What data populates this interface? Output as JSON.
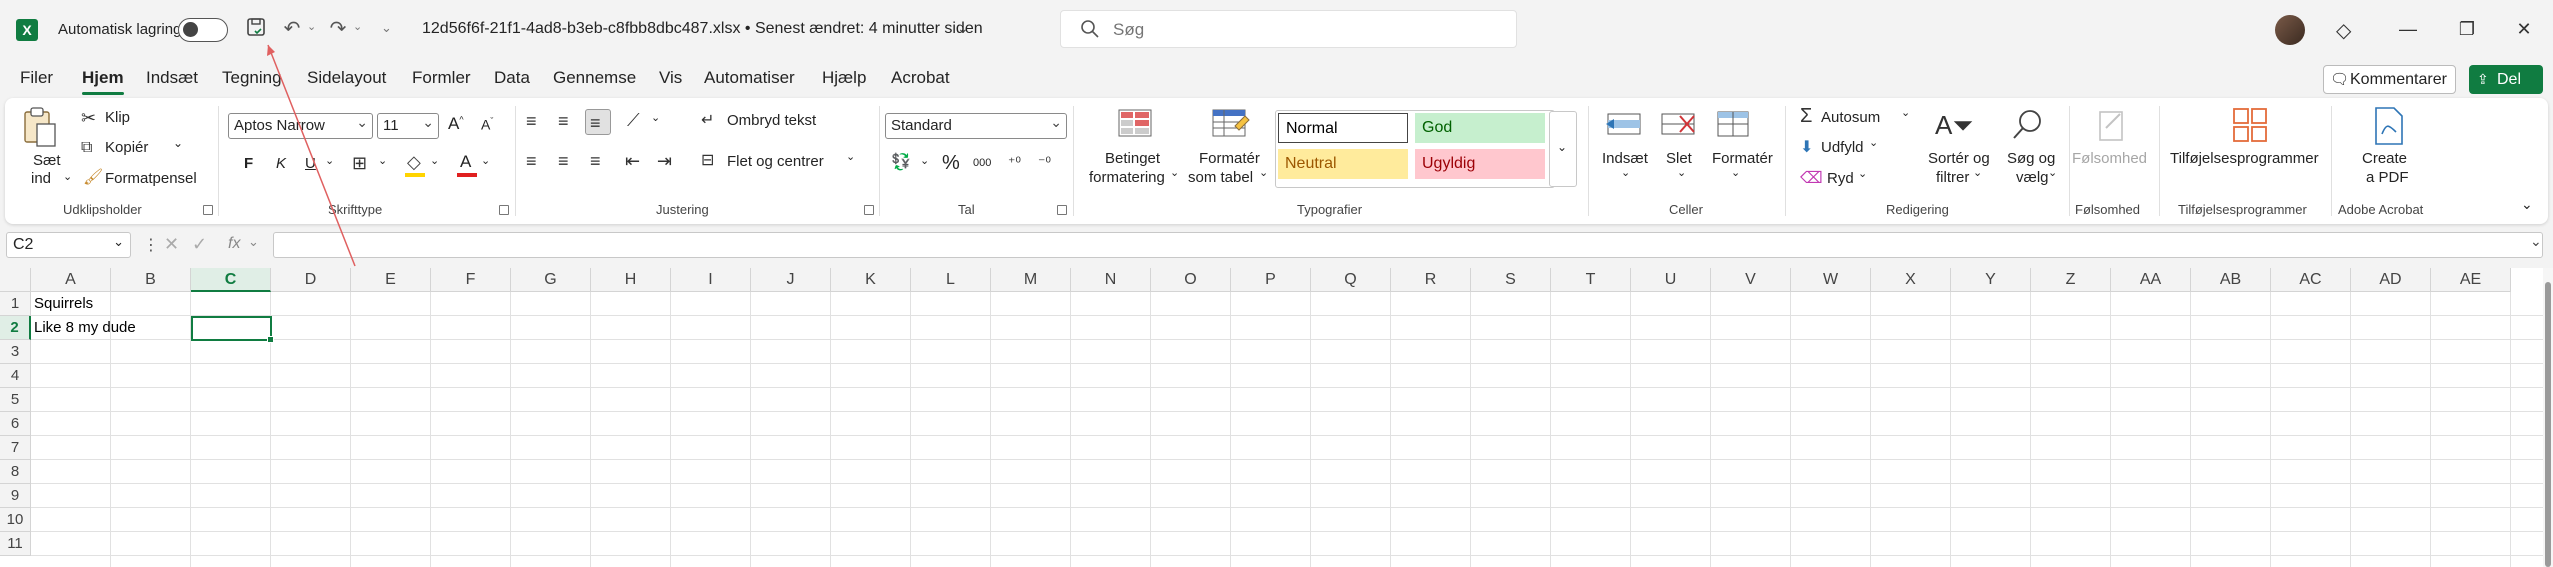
{
  "titlebar": {
    "autosave_label": "Automatisk lagring",
    "doc_title": "12d56f6f-21f1-4ad8-b3eb-c8fbb8dbc487.xlsx • Senest ændret: 4 minutter siden",
    "search_placeholder": "Søg"
  },
  "menu": {
    "tabs": [
      "Filer",
      "Hjem",
      "Indsæt",
      "Tegning",
      "Sidelayout",
      "Formler",
      "Data",
      "Gennemse",
      "Vis",
      "Automatiser",
      "Hjælp",
      "Acrobat"
    ],
    "active_tab": "Hjem",
    "comment_label": "Kommentarer",
    "share_label": "Del"
  },
  "ribbon": {
    "clipboard": {
      "label": "Udklipsholder",
      "paste": [
        "Sæt",
        "ind"
      ],
      "cut": "Klip",
      "copy": "Kopiér",
      "format_painter": "Formatpensel"
    },
    "font": {
      "label": "Skrifttype",
      "name": "Aptos Narrow",
      "size": "11",
      "bold": "F",
      "italic": "K",
      "underline": "U"
    },
    "alignment": {
      "label": "Justering",
      "wrap": "Ombryd tekst",
      "merge": "Flet og centrer"
    },
    "number": {
      "label": "Tal",
      "format": "Standard",
      "thousands": "000"
    },
    "styles": {
      "label": "Typografier",
      "conditional": [
        "Betinget",
        "formatering"
      ],
      "as_table": [
        "Formatér",
        "som tabel"
      ],
      "normal": "Normal",
      "good": "God",
      "neutral": "Neutral",
      "bad": "Ugyldig"
    },
    "cells": {
      "label": "Celler",
      "insert": "Indsæt",
      "delete": "Slet",
      "format": "Formatér"
    },
    "editing": {
      "label": "Redigering",
      "autosum": "Autosum",
      "fill": "Udfyld",
      "clear": "Ryd",
      "sort": [
        "Sortér og",
        "filtrer"
      ],
      "find": [
        "Søg og",
        "vælg"
      ]
    },
    "sensitivity": {
      "label": "Følsomhed",
      "button": "Følsomhed"
    },
    "addins": {
      "label": "Tilføjelsesprogrammer",
      "button": "Tilføjelsesprogrammer"
    },
    "acrobat": {
      "label": "Adobe Acrobat",
      "button": [
        "Create",
        "a PDF"
      ]
    }
  },
  "formula_bar": {
    "name_box": "C2",
    "fx": "fx",
    "value": ""
  },
  "grid": {
    "columns": [
      "A",
      "B",
      "C",
      "D",
      "E",
      "F",
      "G",
      "H",
      "I",
      "J",
      "K",
      "L",
      "M",
      "N",
      "O",
      "P",
      "Q",
      "R",
      "S",
      "T",
      "U",
      "V",
      "W",
      "X",
      "Y",
      "Z",
      "AA",
      "AB",
      "AC",
      "AD",
      "AE"
    ],
    "rows": [
      "1",
      "2",
      "3",
      "4",
      "5",
      "6",
      "7",
      "8",
      "9",
      "10",
      "11"
    ],
    "selected_column": "C",
    "selected_row": "2",
    "cells": {
      "A1": "Squirrels",
      "A2": "Like 8 my dude"
    }
  },
  "colors": {
    "accent": "#107c41",
    "good_bg": "#c6efce",
    "good_fg": "#006100",
    "neutral_bg": "#ffeb9c",
    "neutral_fg": "#9c5700",
    "bad_bg": "#ffc7ce",
    "bad_fg": "#9c0006",
    "annotation_arrow": "#e06060"
  }
}
